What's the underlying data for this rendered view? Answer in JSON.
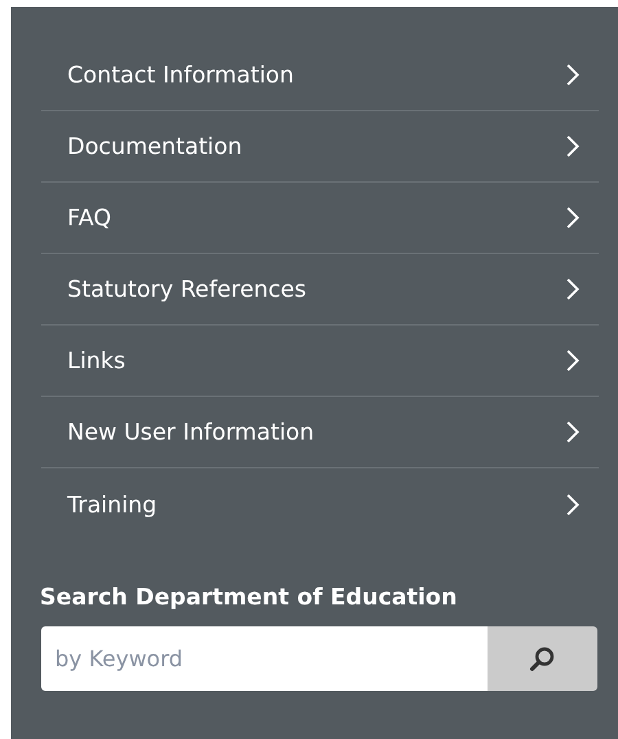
{
  "menu": [
    {
      "label": "Contact Information"
    },
    {
      "label": "Documentation"
    },
    {
      "label": "FAQ"
    },
    {
      "label": "Statutory References"
    },
    {
      "label": "Links"
    },
    {
      "label": "New User Information"
    },
    {
      "label": "Training"
    }
  ],
  "search": {
    "heading": "Search Department of Education",
    "placeholder": "by Keyword"
  }
}
